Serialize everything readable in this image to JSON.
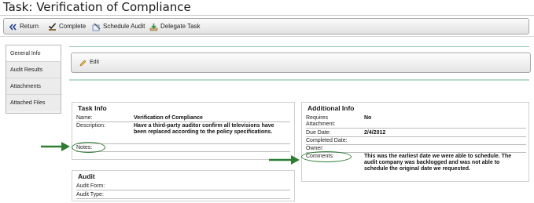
{
  "page": {
    "title": "Task: Verification of Compliance"
  },
  "toolbar": {
    "return_label": "Return",
    "complete_label": "Complete",
    "schedule_audit_label": "Schedule Audit",
    "delegate_task_label": "Delegate Task"
  },
  "sidebar": {
    "items": [
      {
        "label": "General Info",
        "active": true
      },
      {
        "label": "Audit Results"
      },
      {
        "label": "Attachments"
      },
      {
        "label": "Attached Files"
      }
    ]
  },
  "editbar": {
    "edit_label": "Edit"
  },
  "task_info": {
    "title": "Task Info",
    "name_label": "Name:",
    "name_value": "Verification of Compliance",
    "description_label": "Description:",
    "description_value": "Have a third-party auditor confirm all televisions have been replaced according to the policy specifications.",
    "notes_label": "Notes:",
    "notes_value": ""
  },
  "audit": {
    "title": "Audit",
    "audit_form_label": "Audit Form:",
    "audit_type_label": "Audit Type:"
  },
  "additional_info": {
    "title": "Additional Info",
    "requires_attachment_label_1": "Requires",
    "requires_attachment_label_2": "Attachment:",
    "requires_attachment_value": "No",
    "due_date_label": "Due Date:",
    "due_date_value": "2/4/2012",
    "completed_date_label": "Completed Date:",
    "owner_label": "Owner:",
    "comments_label": "Comments:",
    "comments_value": "This was the earliest date we were able to schedule. The audit company was backlogged and was not able to schedule the original date we requested."
  },
  "colors": {
    "highlight": "#2e7d32",
    "accent_rule": "#9fcfb8"
  }
}
